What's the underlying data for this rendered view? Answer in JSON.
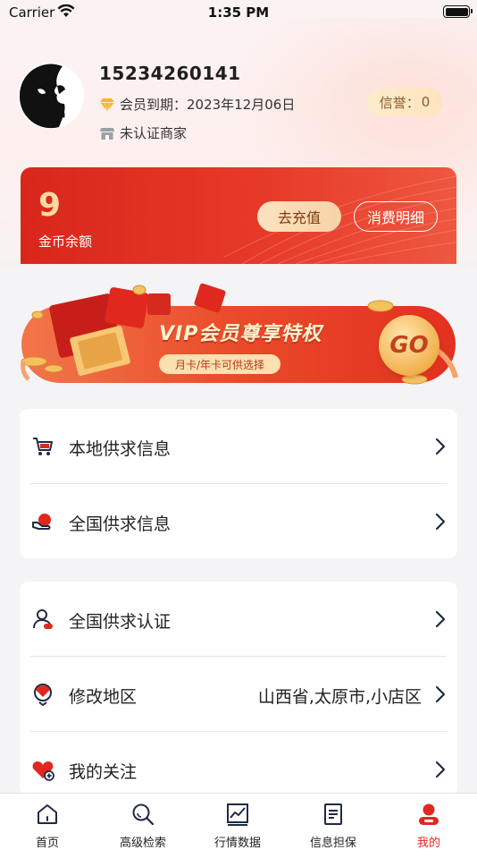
{
  "status_bar": {
    "carrier": "Carrier",
    "time": "1:35 PM"
  },
  "profile": {
    "phone": "15234260141",
    "vip_expiry": "会员到期：2023年12月06日",
    "merchant_status": "未认证商家",
    "credit_label": "信誉：",
    "credit_value": "0"
  },
  "coin_card": {
    "balance": "9",
    "balance_label": "金币余额",
    "recharge_label": "去充值",
    "detail_label": "消费明细"
  },
  "vip_banner": {
    "title": "VIP会员尊享特权",
    "subtitle": "月卡/年卡可供选择",
    "go_label": "GO"
  },
  "menu_group_1": [
    {
      "label": "本地供求信息",
      "icon": "cart-icon"
    },
    {
      "label": "全国供求信息",
      "icon": "hand-heart-icon"
    }
  ],
  "menu_group_2": [
    {
      "label": "全国供求认证",
      "icon": "user-verify-icon"
    },
    {
      "label": "修改地区",
      "value": "山西省,太原市,小店区",
      "icon": "location-icon"
    },
    {
      "label": "我的关注",
      "icon": "heart-plus-icon"
    }
  ],
  "tabbar": [
    {
      "label": "首页",
      "icon": "home-icon"
    },
    {
      "label": "高级检索",
      "icon": "search-icon"
    },
    {
      "label": "行情数据",
      "icon": "chart-icon"
    },
    {
      "label": "信息担保",
      "icon": "document-icon"
    },
    {
      "label": "我的",
      "icon": "profile-icon",
      "active": true
    }
  ],
  "colors": {
    "accent_red": "#e0281e",
    "gold": "#ffd9a0",
    "credit_bg": "#fde4bf"
  }
}
